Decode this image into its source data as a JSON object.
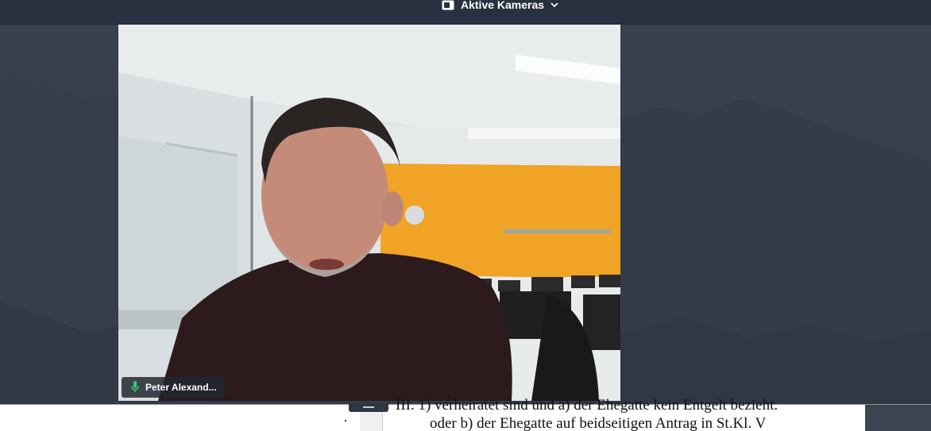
{
  "topbar": {
    "camera_menu_label": "Aktive Kameras",
    "camera_icon": "video-camera-icon",
    "dropdown_icon": "chevron-down-icon"
  },
  "participant": {
    "name": "Peter Alexand...",
    "mic_icon": "microphone-icon",
    "mic_color": "#2ecc71"
  },
  "document": {
    "line_1": "III.   1) verheiratet sind und a) der Ehegatte kein Entgelt bezieht.",
    "line_2": "oder b) der Ehegatte auf beidseitigen Antrag in St.Kl. V"
  },
  "colors": {
    "topbar": "#273140",
    "background": "#39424f",
    "wall_orange": "#f1a326"
  }
}
